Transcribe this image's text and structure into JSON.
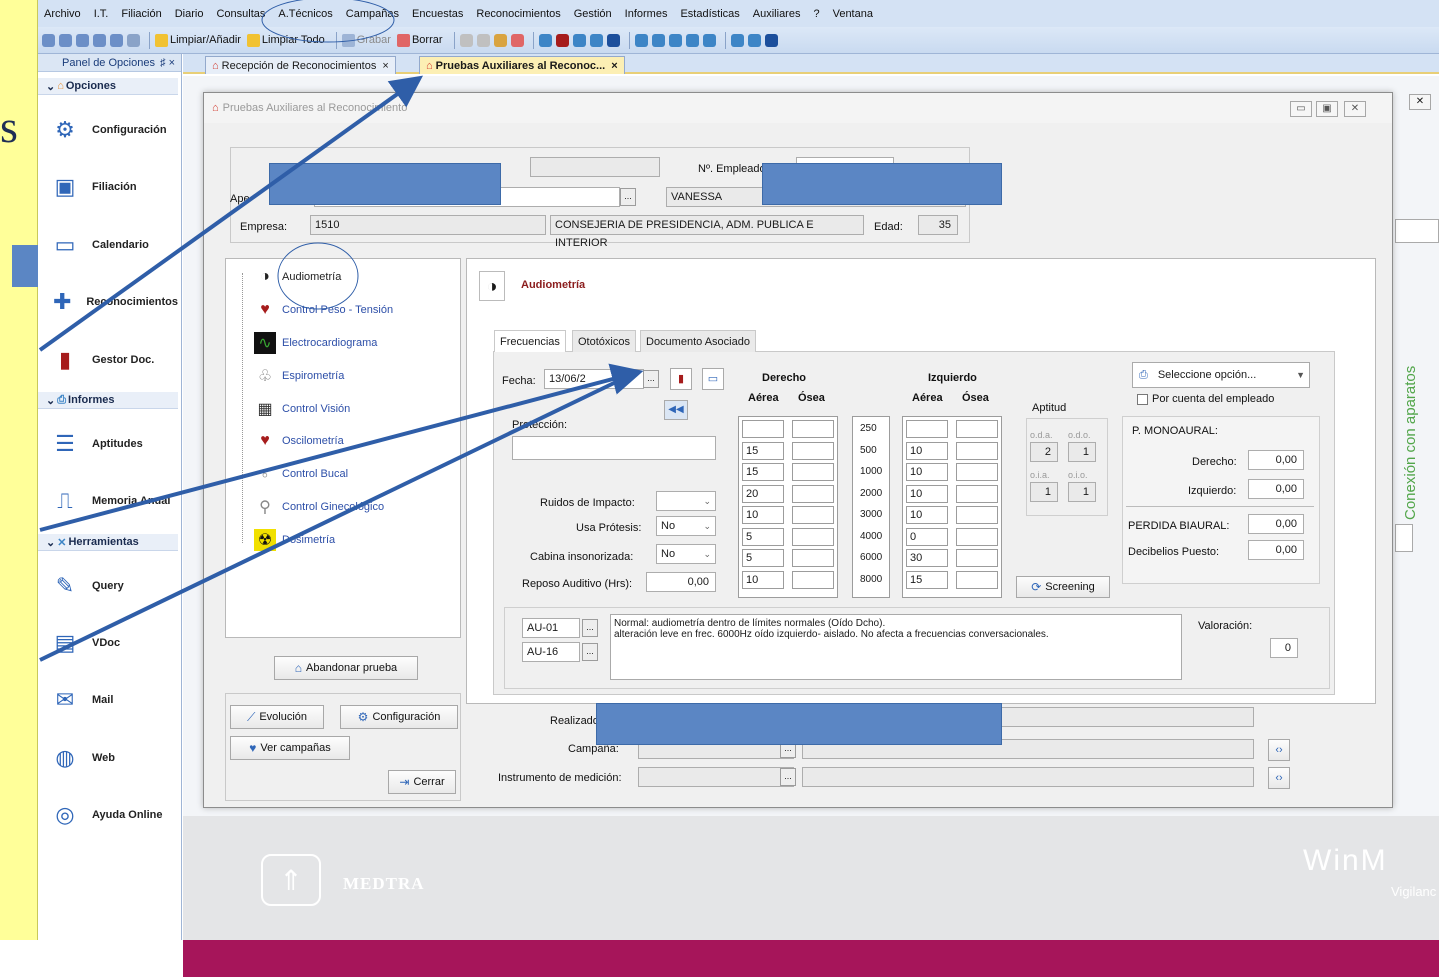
{
  "menu": [
    "Archivo",
    "I.T.",
    "Filiación",
    "Diario",
    "Consultas",
    "A.Técnicos",
    "Campañas",
    "Encuestas",
    "Reconocimientos",
    "Gestión",
    "Informes",
    "Estadísticas",
    "Auxiliares",
    "?",
    "Ventana"
  ],
  "toolbar": {
    "limpiar_anadir": "Limpiar/Añadir",
    "limpiar_todo": "Limpiar Todo",
    "grabar": "Grabar",
    "borrar": "Borrar"
  },
  "sidebar": {
    "panel_title": "Panel de Opciones",
    "pin": "♯ ×",
    "sections": {
      "opciones": "Opciones",
      "informes": "Informes",
      "herramientas": "Herramientas"
    },
    "items": [
      {
        "label": "Configuración"
      },
      {
        "label": "Filiación"
      },
      {
        "label": "Calendario"
      },
      {
        "label": "Reconocimientos"
      },
      {
        "label": "Gestor Doc."
      },
      {
        "label": "Aptitudes"
      },
      {
        "label": "Memoria Anual"
      },
      {
        "label": "Query"
      },
      {
        "label": "VDoc"
      },
      {
        "label": "Mail"
      },
      {
        "label": "Web"
      },
      {
        "label": "Ayuda Online"
      }
    ]
  },
  "tabs": [
    {
      "label": "Recepción de Reconocimientos"
    },
    {
      "label": "Pruebas Auxiliares al Reconoc..."
    }
  ],
  "dialog": {
    "title": "Pruebas Auxiliares al Reconocimiento",
    "n_empleado_label": "Nº. Empleado",
    "apellidos_label": "Ape",
    "nombre": "VANESSA",
    "empresa_label": "Empresa:",
    "empresa_code": "1510",
    "empresa_name": "CONSEJERIA DE PRESIDENCIA, ADM. PUBLICA E INTERIOR",
    "edad_label": "Edad:",
    "edad": "35",
    "tree": [
      "Audiometría",
      "Control Peso - Tensión",
      "Electrocardiograma",
      "Espirometría",
      "Control Visión",
      "Oscilometría",
      "Control Bucal",
      "Control Ginecológico",
      "Dosimetría"
    ],
    "abandonar": "Abandonar prueba",
    "evolucion": "Evolución",
    "configuracion": "Configuración",
    "ver_campanas": "Ver campañas",
    "cerrar": "Cerrar",
    "detail_title": "Audiometría",
    "subtabs": [
      "Frecuencias",
      "Ototóxicos",
      "Documento Asociado"
    ],
    "fecha_label": "Fecha:",
    "fecha": "13/06/2",
    "proteccion_label": "Protección:",
    "derecho": "Derecho",
    "izquierdo": "Izquierdo",
    "aerea": "Aérea",
    "osea": "Ósea",
    "aptitud": "Aptitud",
    "oda": "o.d.a.",
    "odo": "o.d.o.",
    "oia": "o.i.a.",
    "oio": "o.i.o.",
    "oda_v": "2",
    "odo_v": "1",
    "oia_v": "1",
    "oio_v": "1",
    "hz": [
      "250",
      "500",
      "1000",
      "2000",
      "3000",
      "4000",
      "6000",
      "8000"
    ],
    "der_aerea": [
      "",
      "15",
      "15",
      "20",
      "10",
      "5",
      "5",
      "10"
    ],
    "izq_aerea": [
      "",
      "10",
      "10",
      "10",
      "10",
      "0",
      "30",
      "15"
    ],
    "ruidos_label": "Ruidos de Impacto:",
    "protesis_label": "Usa Prótesis:",
    "protesis": "No",
    "cabina_label": "Cabina insonorizada:",
    "cabina": "No",
    "reposo_label": "Reposo Auditivo (Hrs):",
    "reposo": "0,00",
    "seleccione": "Seleccione opción...",
    "por_cuenta": "Por cuenta del empleado",
    "monoaural": "P. MONOAURAL:",
    "derecho_label": "Derecho:",
    "izquierdo_label": "Izquierdo:",
    "derecho_val": "0,00",
    "izquierdo_val": "0,00",
    "perdida_label": "PERDIDA BIAURAL:",
    "perdida_val": "0,00",
    "decibelios_label": "Decibelios Puesto:",
    "decibelios_val": "0,00",
    "screening": "Screening",
    "codes": [
      "AU-01",
      "AU-16"
    ],
    "obs_line1": "Normal: audiometría dentro de límites normales (Oído Dcho).",
    "obs_line2": "alteración leve en frec. 6000Hz oído izquierdo- aislado. No afecta a frecuencias conversacionales.",
    "valoracion_label": "Valoración:",
    "valoracion": "0",
    "realizado_label": "Realizado",
    "campana_label": "Campaña:",
    "instrumento_label": "Instrumento de medición:"
  },
  "footer": {
    "brand": "MEDTRA",
    "winm": "WinM",
    "vig": "Vigilanc"
  },
  "side_vertical": "Conexión con aparatos",
  "slide_letter": "s",
  "colors": {
    "accent": "#2f66b8",
    "redaction": "#5b86c4",
    "footer": "#a6155a",
    "yellow": "#ffff99"
  }
}
